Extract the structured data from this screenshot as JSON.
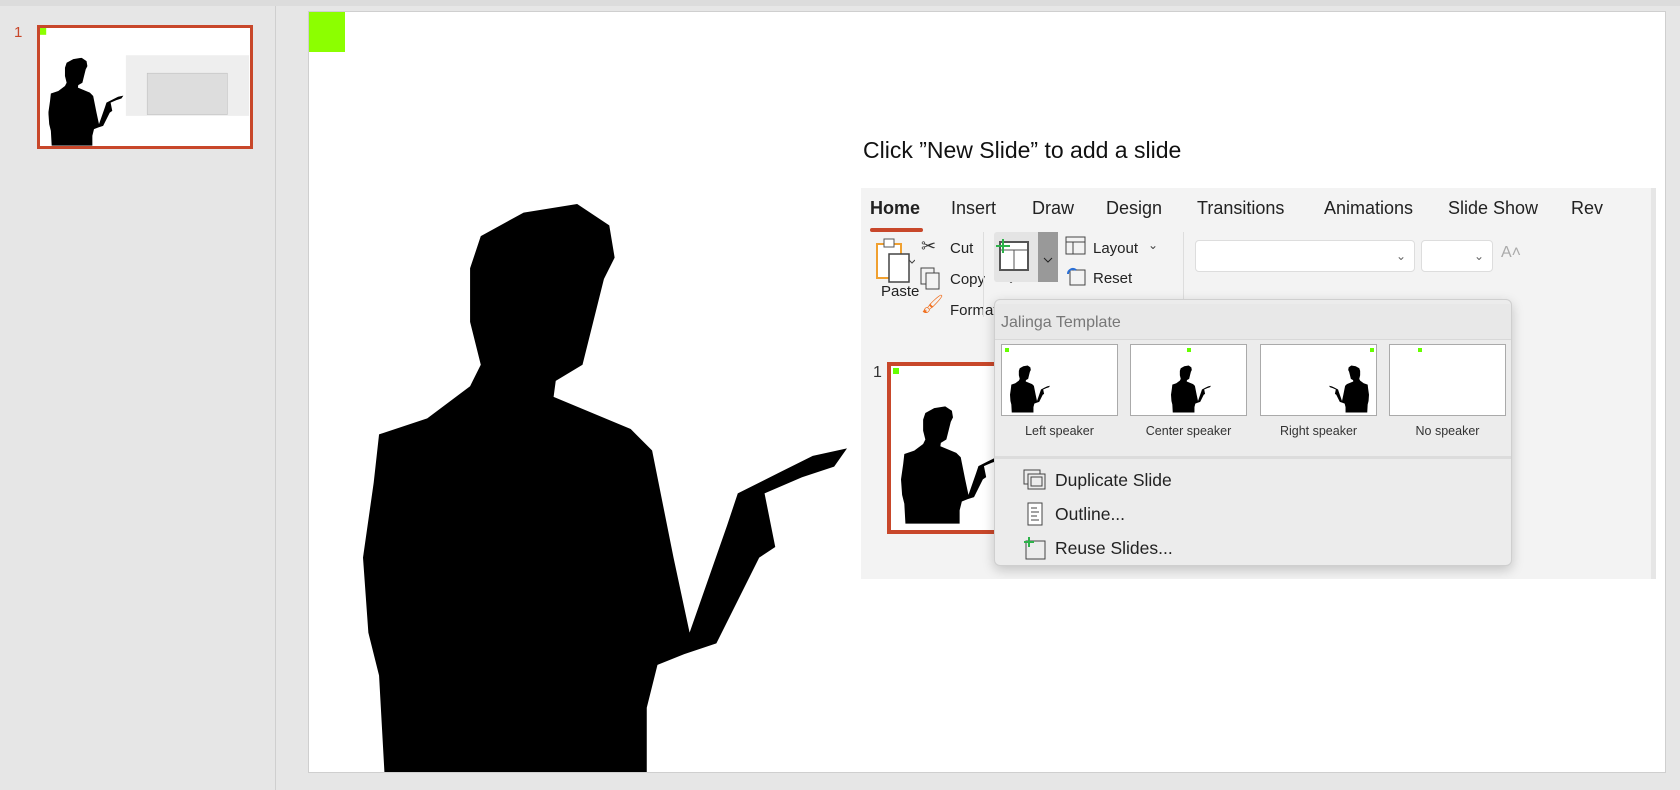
{
  "slide_panel": {
    "slide_number": "1"
  },
  "slide": {
    "title": "Click ”New Slide” to add a slide",
    "accent_color": "#8cff00",
    "selection_color": "#c8472a"
  },
  "embedded_ui": {
    "tabs": [
      "Home",
      "Insert",
      "Draw",
      "Design",
      "Transitions",
      "Animations",
      "Slide Show",
      "Rev"
    ],
    "active_tab": "Home",
    "clipboard": {
      "paste": "Paste",
      "cut": "Cut",
      "copy": "Copy",
      "format": "Format"
    },
    "slides": {
      "layout": "Layout",
      "reset": "Reset"
    },
    "font_size_icon": "increase-font-icon",
    "slide_number": "1",
    "menu": {
      "header": "Jalinga Template",
      "layouts": [
        "Left speaker",
        "Center speaker",
        "Right speaker",
        "No speaker"
      ],
      "items": [
        "Duplicate Slide",
        "Outline...",
        "Reuse Slides..."
      ]
    }
  }
}
